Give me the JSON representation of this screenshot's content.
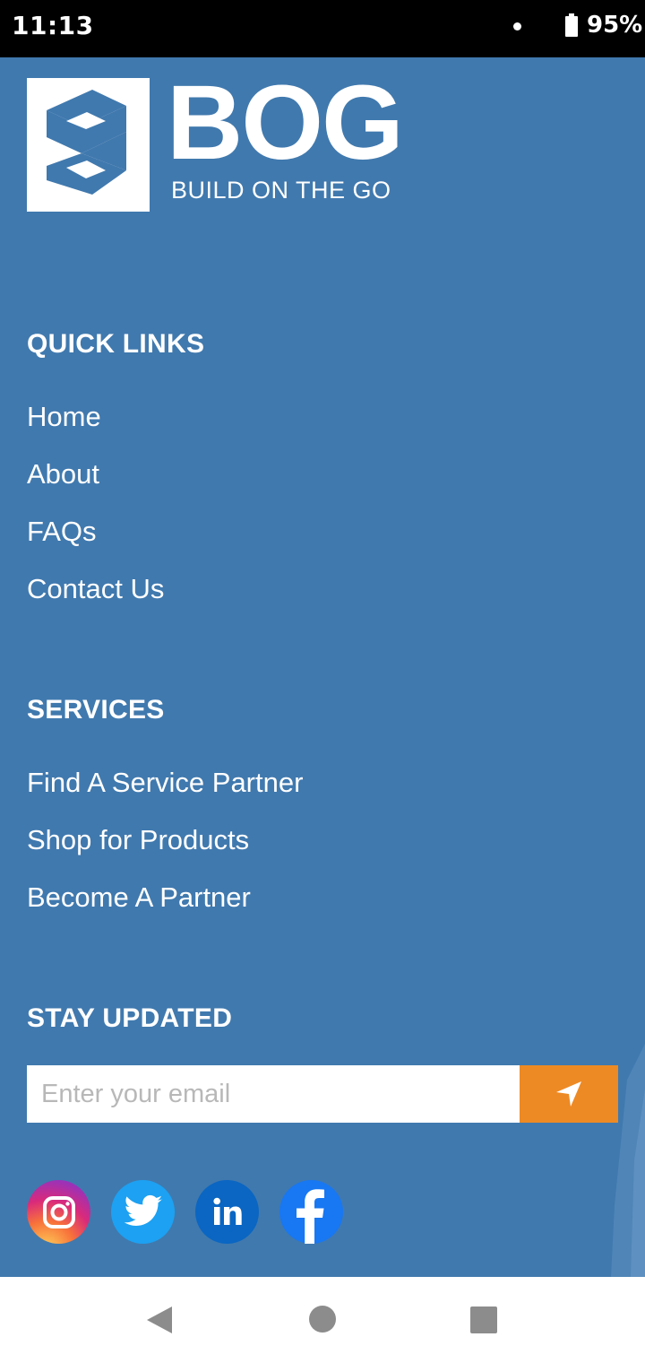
{
  "status_bar": {
    "time": "11:13",
    "battery_percent": "95%"
  },
  "brand": {
    "title": "BOG",
    "tagline": "BUILD ON THE GO"
  },
  "quick_links": {
    "heading": "QUICK LINKS",
    "items": [
      "Home",
      "About",
      "FAQs",
      "Contact Us"
    ]
  },
  "services": {
    "heading": "SERVICES",
    "items": [
      "Find A Service Partner",
      "Shop for Products",
      "Become A Partner"
    ]
  },
  "newsletter": {
    "heading": "STAY UPDATED",
    "email_placeholder": "Enter your email",
    "submit_icon": "send-arrow-icon"
  },
  "social": [
    "instagram",
    "twitter",
    "linkedin",
    "facebook"
  ],
  "colors": {
    "footer_bg": "#4079ae",
    "accent": "#ed8a24",
    "linkedin": "#0a66c2",
    "twitter": "#1da1f2",
    "facebook": "#1877f2"
  },
  "nav": [
    "back",
    "home",
    "recents"
  ]
}
